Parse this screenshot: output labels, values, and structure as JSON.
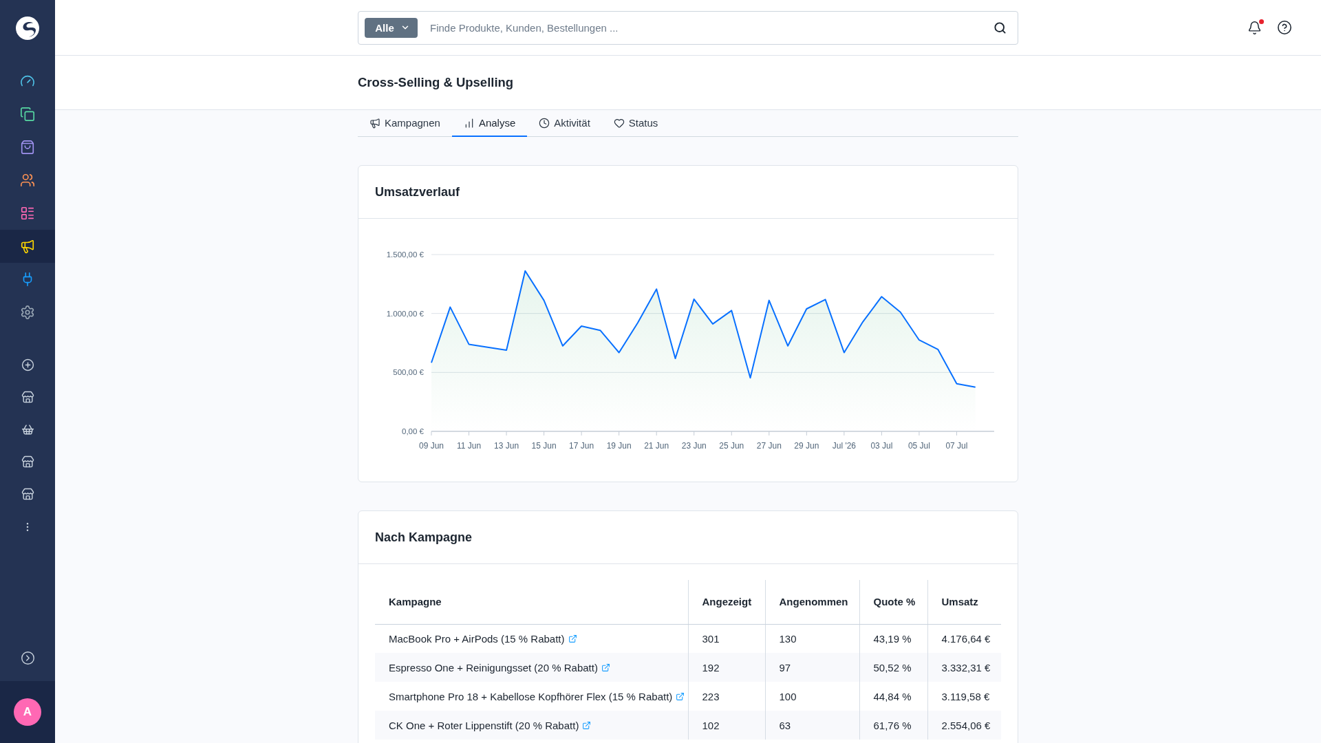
{
  "sidebar": {
    "items": [
      {
        "color": "#4fc3e8",
        "selected": false
      },
      {
        "color": "#57d9a3",
        "selected": false
      },
      {
        "color": "#a092f0",
        "selected": false
      },
      {
        "color": "#ff9354",
        "selected": false
      },
      {
        "color": "#ff68b4",
        "selected": false
      },
      {
        "color": "#ffd700",
        "selected": true
      },
      {
        "color": "#189eff",
        "selected": false
      },
      {
        "color": "#9aa8b5",
        "selected": false
      }
    ],
    "avatar": {
      "initial": "A"
    }
  },
  "topbar": {
    "search": {
      "scope": "Alle",
      "placeholder": "Finde Produkte, Kunden, Bestellungen ..."
    },
    "notifications_unread": true
  },
  "page": {
    "title": "Cross-Selling & Upselling",
    "tabs": [
      {
        "label": "Kampagnen",
        "selected": false
      },
      {
        "label": "Analyse",
        "selected": true
      },
      {
        "label": "Aktivität",
        "selected": false
      },
      {
        "label": "Status",
        "selected": false
      }
    ]
  },
  "revenue_card": {
    "title": "Umsatzverlauf",
    "chart_data": {
      "type": "area",
      "categories": [
        "09 Jun",
        null,
        "11 Jun",
        null,
        "13 Jun",
        null,
        "15 Jun",
        null,
        "17 Jun",
        null,
        "19 Jun",
        null,
        "21 Jun",
        null,
        "23 Jun",
        null,
        "25 Jun",
        null,
        "27 Jun",
        null,
        "29 Jun",
        null,
        "Jul '26",
        null,
        "03 Jul",
        null,
        "05 Jul",
        null,
        "07 Jul",
        null
      ],
      "ylim": [
        0,
        1500
      ],
      "yticks": [
        {
          "value": 0,
          "label": "0,00 €"
        },
        {
          "value": 500,
          "label": "500,00 €"
        },
        {
          "value": 1000,
          "label": "1.000,00 €"
        },
        {
          "value": 1500,
          "label": "1.500,00 €"
        }
      ],
      "series": [
        {
          "color": "#0870ff",
          "values": [
            582,
            1054,
            739,
            714,
            689,
            1361,
            1111,
            725,
            893,
            857,
            668,
            921,
            1207,
            618,
            1121,
            911,
            1025,
            454,
            1111,
            725,
            1039,
            1118,
            668,
            929,
            1143,
            1011,
            775,
            696,
            404,
            375
          ]
        }
      ]
    }
  },
  "campaign_card": {
    "title": "Nach Kampagne",
    "table": {
      "columns": [
        "Kampagne",
        "Angezeigt",
        "Angenommen",
        "Quote %",
        "Umsatz"
      ],
      "rows": [
        {
          "cells": [
            "MacBook Pro + AirPods (15 % Rabatt)",
            "301",
            "130",
            "43,19 %",
            "4.176,64 €"
          ]
        },
        {
          "cells": [
            "Espresso One + Reinigungsset (20 % Rabatt)",
            "192",
            "97",
            "50,52 %",
            "3.332,31 €"
          ]
        },
        {
          "cells": [
            "Smartphone Pro 18 + Kabellose Kopfhörer Flex (15 % Rabatt)",
            "223",
            "100",
            "44,84 %",
            "3.119,58 €"
          ]
        },
        {
          "cells": [
            "CK One + Roter Lippenstift (20 % Rabatt)",
            "102",
            "63",
            "61,76 %",
            "2.554,06 €"
          ]
        }
      ]
    }
  }
}
